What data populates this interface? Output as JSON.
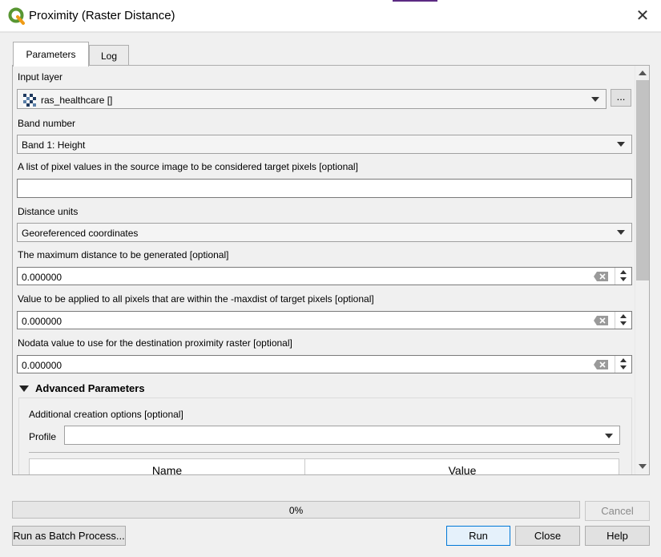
{
  "window": {
    "title": "Proximity (Raster Distance)",
    "close_glyph": "✕",
    "accent_color": "#5b2a82"
  },
  "tabs": [
    {
      "label": "Parameters",
      "active": true
    },
    {
      "label": "Log",
      "active": false
    }
  ],
  "params": {
    "input_layer": {
      "label": "Input layer",
      "value": "ras_healthcare []",
      "browse_label": "..."
    },
    "band": {
      "label": "Band number",
      "value": "Band 1: Height"
    },
    "target_pixels": {
      "label": "A list of pixel values in the source image to be considered target pixels [optional]",
      "value": ""
    },
    "distance_units": {
      "label": "Distance units",
      "value": "Georeferenced coordinates"
    },
    "max_distance": {
      "label": "The maximum distance to be generated [optional]",
      "value": "0.000000"
    },
    "replace_value": {
      "label": "Value to be applied to all pixels that are within the -maxdist of target pixels [optional]",
      "value": "0.000000"
    },
    "nodata": {
      "label": "Nodata value to use for the destination proximity raster [optional]",
      "value": "0.000000"
    }
  },
  "advanced": {
    "title": "Advanced Parameters",
    "creation_options_label": "Additional creation options [optional]",
    "profile_label": "Profile",
    "profile_value": "",
    "columns": [
      "Name",
      "Value"
    ]
  },
  "progress": {
    "text": "0%",
    "value": 0,
    "fill_color": "#06b025"
  },
  "buttons": {
    "cancel": "Cancel",
    "batch": "Run as Batch Process...",
    "run": "Run",
    "close": "Close",
    "help": "Help"
  },
  "icons": {
    "app": "qgis-logo-icon",
    "layer": "raster-layer-icon",
    "clear": "clear-field-icon"
  }
}
